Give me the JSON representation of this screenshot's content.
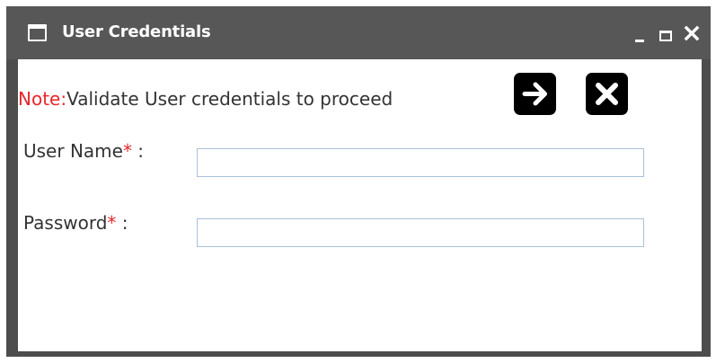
{
  "window": {
    "title": "User Credentials",
    "controls": {
      "minimize_icon": "minimize-icon",
      "maximize_icon": "maximize-icon",
      "close_icon": "close-icon"
    }
  },
  "note": {
    "label": "Note:",
    "text": "Validate User credentials to proceed"
  },
  "actions": {
    "proceed_icon": "arrow-right-icon",
    "cancel_icon": "close-icon"
  },
  "form": {
    "username": {
      "label": "User Name",
      "required_mark": "*",
      "separator": " :",
      "value": ""
    },
    "password": {
      "label": "Password",
      "required_mark": "*",
      "separator": " :",
      "value": ""
    }
  },
  "colors": {
    "titlebar": "#575757",
    "frame": "#4d4d4d",
    "required": "#e8262a",
    "input_border": "#a9bfd8",
    "button": "#000000"
  }
}
